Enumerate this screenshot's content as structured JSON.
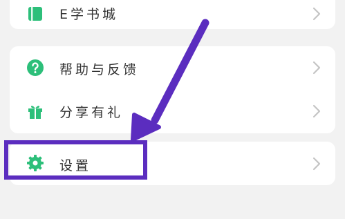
{
  "menu": {
    "bookstore_label": "E学书城",
    "help_label": "帮助与反馈",
    "share_label": "分享有礼",
    "settings_label": "设置"
  },
  "colors": {
    "icon_green": "#2dbf7a",
    "annotation_purple": "#5b2dbf",
    "chevron_gray": "#c4c4c4"
  },
  "icons": [
    "book-icon",
    "help-icon",
    "gift-icon",
    "gear-icon",
    "chevron-right-icon"
  ]
}
